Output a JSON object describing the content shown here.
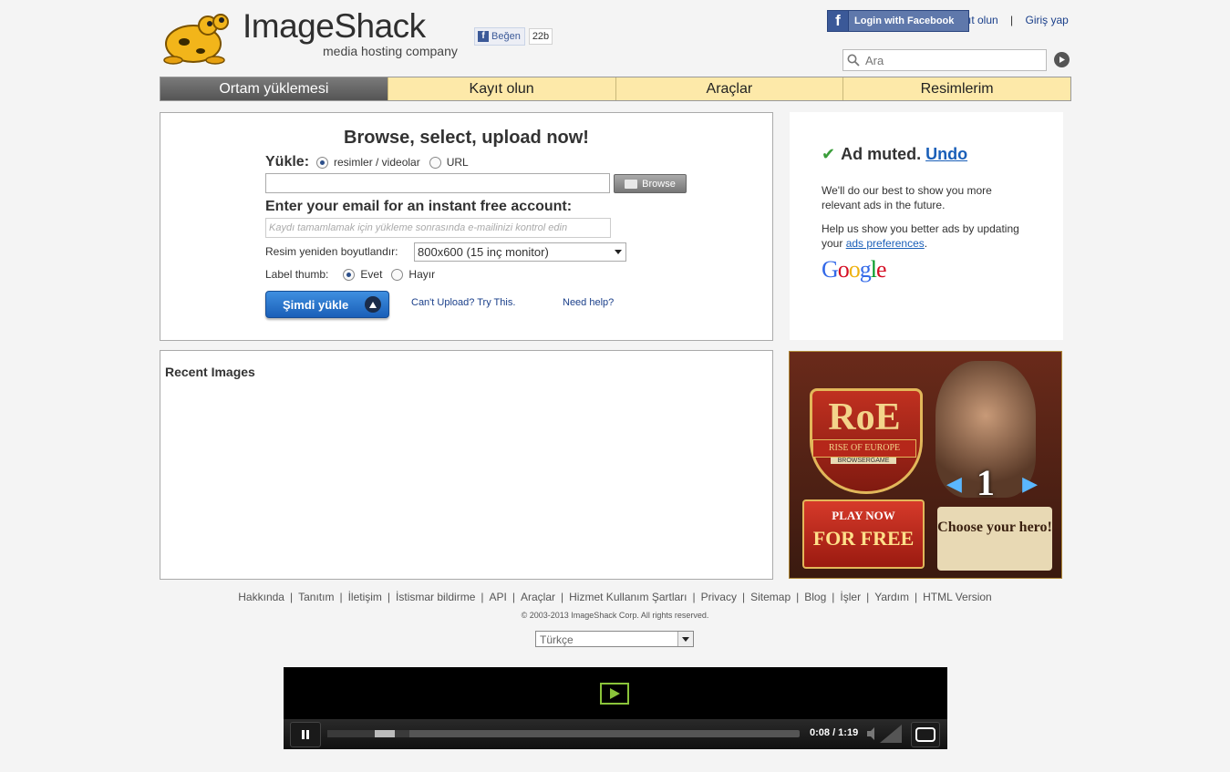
{
  "header": {
    "logo_text": "ImageShack",
    "logo_sub": "media hosting company",
    "fb_like_label": "Beğen",
    "fb_like_count": "22b",
    "fb_login_label": "Login with Facebook",
    "register_link": "ıt olun",
    "separator": "|",
    "login_link": "Giriş yap",
    "search_placeholder": "Ara"
  },
  "nav": {
    "tabs": [
      {
        "label": "Ortam yüklemesi",
        "active": true
      },
      {
        "label": "Kayıt olun"
      },
      {
        "label": "Araçlar"
      },
      {
        "label": "Resimlerim"
      }
    ]
  },
  "upload": {
    "title": "Browse, select, upload now!",
    "yukle_label": "Yükle:",
    "option_media": "resimler / videolar",
    "option_url": "URL",
    "browse_label": "Browse",
    "email_title": "Enter your email for an instant free account:",
    "email_placeholder": "Kaydı tamamlamak için yükleme sonrasında e-mailinizi kontrol edin",
    "resize_label": "Resim yeniden boyutlandır:",
    "resize_value": "800x600 (15 inç monitor)",
    "label_thumb": "Label thumb:",
    "thumb_yes": "Evet",
    "thumb_no": "Hayır",
    "submit_label": "Şimdi yükle",
    "cant_upload": "Can't Upload? Try This.",
    "need_help": "Need help?"
  },
  "recent": {
    "title": "Recent Images"
  },
  "ad_muted": {
    "title": "Ad muted.",
    "undo": "Undo",
    "p1": "We'll do our best to show you more relevant ads in the future.",
    "p2_prefix": "Help us show you better ads by updating your ",
    "p2_link": "ads preferences",
    "p2_suffix": ".",
    "google": "Google"
  },
  "banner": {
    "logo": "RoE",
    "rise": "RISE OF EUROPE",
    "browsergame": "BROWSERGAME",
    "number": "1",
    "play_now": "PLAY NOW",
    "for_free": "FOR FREE",
    "hero": "Choose your hero!"
  },
  "footer": {
    "links": [
      "Hakkında",
      "Tanıtım",
      "İletişim",
      "İstismar bildirme",
      "API",
      "Araçlar",
      "Hizmet Kullanım Şartları",
      "Privacy",
      "Sitemap",
      "Blog",
      "İşler",
      "Yardım",
      "HTML Version"
    ],
    "copyright": "© 2003-2013 ImageShack Corp. All rights reserved.",
    "language": "Türkçe"
  },
  "player": {
    "time": "0:08 / 1:19",
    "progress_fraction": 0.1
  },
  "colors": {
    "nav_tab": "#fde9a9",
    "accent_blue": "#1a5fb8",
    "fb_blue": "#3b5998"
  }
}
